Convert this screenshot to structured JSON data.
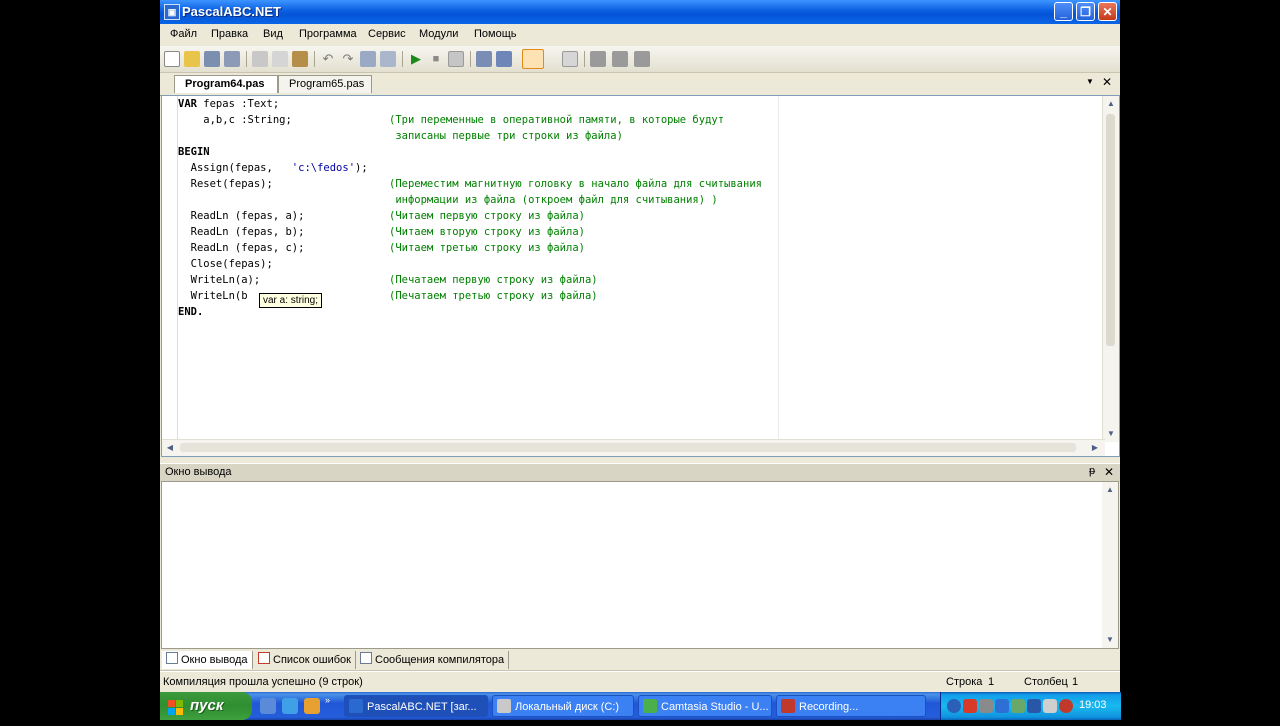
{
  "window": {
    "title": "PascalABC.NET",
    "controls": {
      "minimize": "_",
      "maximize": "❐",
      "close": "✕"
    }
  },
  "menu": [
    "Файл",
    "Правка",
    "Вид",
    "Программа",
    "Сервис",
    "Модули",
    "Помощь"
  ],
  "tabs": [
    {
      "label": "Program64.pas",
      "active": true
    },
    {
      "label": "Program65.pas",
      "active": false
    }
  ],
  "tab_controls": {
    "dropdown": "▼",
    "close": "✕"
  },
  "editor": {
    "lines": [
      {
        "kw": "VAR",
        "code": " fepas :Text;",
        "comment": ""
      },
      {
        "kw": "",
        "code": "    a,b,c :String;",
        "comment": "(Три переменные в оперативной памяти, в которые будут"
      },
      {
        "kw": "",
        "code": "",
        "comment": " записаны первые три строки из файла)"
      },
      {
        "kw": "BEGIN",
        "code": "",
        "comment": ""
      },
      {
        "kw": "",
        "code": "  Assign(fepas,   ",
        "str": "'c:\\fedos'",
        "tail": ");",
        "comment": ""
      },
      {
        "kw": "",
        "code": "  Reset(fepas);",
        "comment": "(Переместим магнитную головку в начало файла для считывания"
      },
      {
        "kw": "",
        "code": "",
        "comment": " информации из файла (откроем файл для считывания) )"
      },
      {
        "kw": "",
        "code": "  ReadLn (fepas, a);",
        "comment": "(Читаем первую строку из файла)"
      },
      {
        "kw": "",
        "code": "  ReadLn (fepas, b);",
        "comment": "(Читаем вторую строку из файла)"
      },
      {
        "kw": "",
        "code": "  ReadLn (fepas, c);",
        "comment": "(Читаем третью строку из файла)"
      },
      {
        "kw": "",
        "code": "  Close(fepas);",
        "comment": ""
      },
      {
        "kw": "",
        "code": "  WriteLn(a);",
        "comment": "(Печатаем первую строку из файла)"
      },
      {
        "kw": "",
        "code": "  WriteLn(b",
        "comment": "(Печатаем третью строку из файла)"
      },
      {
        "kw": "END.",
        "code": "",
        "comment": ""
      }
    ],
    "tooltip": "var a: string;",
    "scroll_up": "▲",
    "scroll_down": "▼",
    "scroll_left": "◀",
    "scroll_right": "▶"
  },
  "output": {
    "title": "Окно вывода",
    "pin": "ᵽ",
    "close": "✕"
  },
  "bottom_tabs": [
    "Окно вывода",
    "Список ошибок",
    "Сообщения компилятора"
  ],
  "status": {
    "message": "Компиляция прошла успешно (9 строк)",
    "row_label": "Строка",
    "row": "1",
    "col_label": "Столбец",
    "col": "1"
  },
  "taskbar": {
    "start": "пуск",
    "tasks": [
      "PascalABC.NET [заг...",
      "Локальный диск (C:)",
      "Camtasia Studio - U...",
      "Recording..."
    ],
    "clock": "19:03"
  },
  "colors": {
    "titlebar": "#0A5FE0",
    "comment": "#008000",
    "taskbar": "#245EDB",
    "start": "#3C9A3C"
  }
}
